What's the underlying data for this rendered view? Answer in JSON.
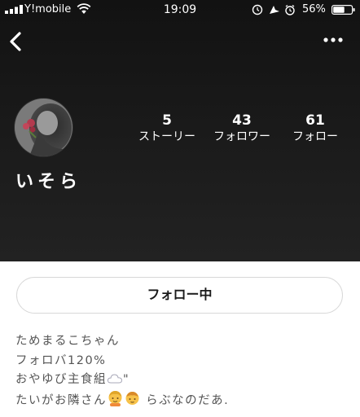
{
  "status_bar": {
    "carrier": "Y!mobile",
    "time": "19:09",
    "battery_percent": "56%"
  },
  "nav": {
    "back_icon": "chevron-left-icon",
    "more_icon": "ellipsis-icon"
  },
  "profile": {
    "name": "いそら",
    "stats": [
      {
        "value": "5",
        "label": "ストーリー"
      },
      {
        "value": "43",
        "label": "フォロワー"
      },
      {
        "value": "61",
        "label": "フォロー"
      }
    ]
  },
  "follow_button": {
    "label": "フォロー中"
  },
  "bio": {
    "line1": "ためまるこちゃん",
    "line2": "フォロバ120%",
    "line3_text": "おやゆび主食組",
    "line3_suffix": "\"",
    "line4_prefix": "たいがお隣さん",
    "line4_suffix": " らぶなのだあ.",
    "emojis": [
      "cloud-emoji",
      "person-emoji",
      "child-emoji"
    ]
  },
  "colors": {
    "header_bg": "#1b1b1b",
    "text_light": "#ffffff",
    "bio_text": "#555555",
    "button_border": "#d8d8d8"
  }
}
